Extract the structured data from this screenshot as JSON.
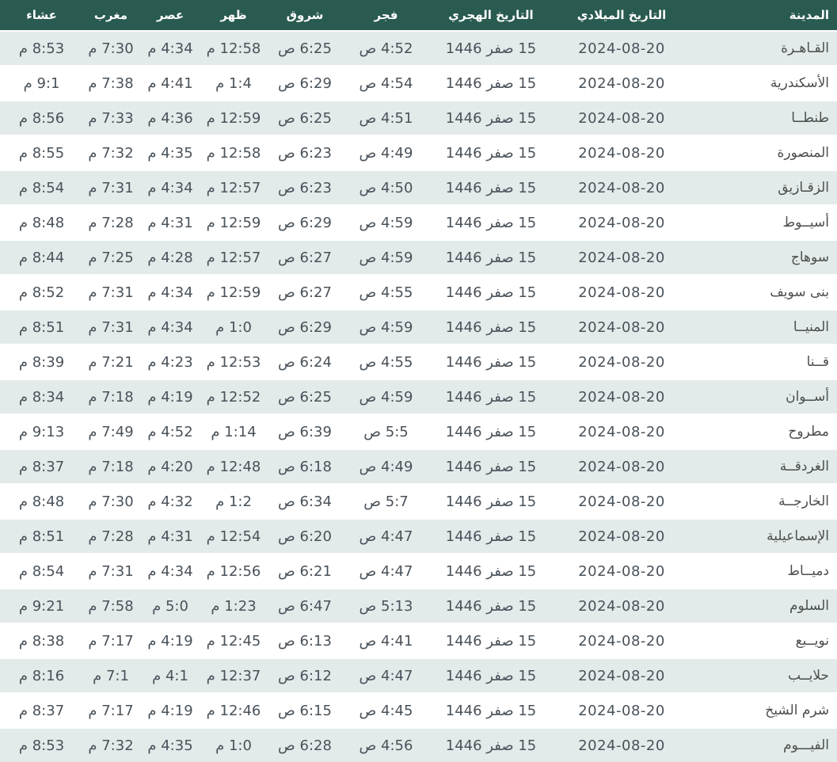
{
  "table": {
    "columns": [
      {
        "key": "city",
        "label": "المدينة"
      },
      {
        "key": "gregorian",
        "label": "التاريخ الميلادي"
      },
      {
        "key": "hijri",
        "label": "التاريخ الهجري"
      },
      {
        "key": "fajr",
        "label": "فجر"
      },
      {
        "key": "shuruq",
        "label": "شروق"
      },
      {
        "key": "dhuhr",
        "label": "ظهر"
      },
      {
        "key": "asr",
        "label": "عصر"
      },
      {
        "key": "maghrib",
        "label": "مغرب"
      },
      {
        "key": "isha",
        "label": "عشاء"
      }
    ],
    "rows": [
      {
        "city": "القـاهـرة",
        "gregorian": "2024-08-20",
        "hijri": "15 صفر 1446",
        "fajr": "4:52 ص",
        "shuruq": "6:25 ص",
        "dhuhr": "12:58 م",
        "asr": "4:34 م",
        "maghrib": "7:30 م",
        "isha": "8:53 م"
      },
      {
        "city": "الأسكندرية",
        "gregorian": "2024-08-20",
        "hijri": "15 صفر 1446",
        "fajr": "4:54 ص",
        "shuruq": "6:29 ص",
        "dhuhr": "1:4 م",
        "asr": "4:41 م",
        "maghrib": "7:38 م",
        "isha": "9:1 م"
      },
      {
        "city": "طنطــا",
        "gregorian": "2024-08-20",
        "hijri": "15 صفر 1446",
        "fajr": "4:51 ص",
        "shuruq": "6:25 ص",
        "dhuhr": "12:59 م",
        "asr": "4:36 م",
        "maghrib": "7:33 م",
        "isha": "8:56 م"
      },
      {
        "city": "المنصورة",
        "gregorian": "2024-08-20",
        "hijri": "15 صفر 1446",
        "fajr": "4:49 ص",
        "shuruq": "6:23 ص",
        "dhuhr": "12:58 م",
        "asr": "4:35 م",
        "maghrib": "7:32 م",
        "isha": "8:55 م"
      },
      {
        "city": "الزقـازيق",
        "gregorian": "2024-08-20",
        "hijri": "15 صفر 1446",
        "fajr": "4:50 ص",
        "shuruq": "6:23 ص",
        "dhuhr": "12:57 م",
        "asr": "4:34 م",
        "maghrib": "7:31 م",
        "isha": "8:54 م"
      },
      {
        "city": "أسيــوط",
        "gregorian": "2024-08-20",
        "hijri": "15 صفر 1446",
        "fajr": "4:59 ص",
        "shuruq": "6:29 ص",
        "dhuhr": "12:59 م",
        "asr": "4:31 م",
        "maghrib": "7:28 م",
        "isha": "8:48 م"
      },
      {
        "city": "سوهاج",
        "gregorian": "2024-08-20",
        "hijri": "15 صفر 1446",
        "fajr": "4:59 ص",
        "shuruq": "6:27 ص",
        "dhuhr": "12:57 م",
        "asr": "4:28 م",
        "maghrib": "7:25 م",
        "isha": "8:44 م"
      },
      {
        "city": "بنى سويف",
        "gregorian": "2024-08-20",
        "hijri": "15 صفر 1446",
        "fajr": "4:55 ص",
        "shuruq": "6:27 ص",
        "dhuhr": "12:59 م",
        "asr": "4:34 م",
        "maghrib": "7:31 م",
        "isha": "8:52 م"
      },
      {
        "city": "المنيــا",
        "gregorian": "2024-08-20",
        "hijri": "15 صفر 1446",
        "fajr": "4:59 ص",
        "shuruq": "6:29 ص",
        "dhuhr": "1:0 م",
        "asr": "4:34 م",
        "maghrib": "7:31 م",
        "isha": "8:51 م"
      },
      {
        "city": "قــنا",
        "gregorian": "2024-08-20",
        "hijri": "15 صفر 1446",
        "fajr": "4:55 ص",
        "shuruq": "6:24 ص",
        "dhuhr": "12:53 م",
        "asr": "4:23 م",
        "maghrib": "7:21 م",
        "isha": "8:39 م"
      },
      {
        "city": "أســوان",
        "gregorian": "2024-08-20",
        "hijri": "15 صفر 1446",
        "fajr": "4:59 ص",
        "shuruq": "6:25 ص",
        "dhuhr": "12:52 م",
        "asr": "4:19 م",
        "maghrib": "7:18 م",
        "isha": "8:34 م"
      },
      {
        "city": "مطروح",
        "gregorian": "2024-08-20",
        "hijri": "15 صفر 1446",
        "fajr": "5:5 ص",
        "shuruq": "6:39 ص",
        "dhuhr": "1:14 م",
        "asr": "4:52 م",
        "maghrib": "7:49 م",
        "isha": "9:13 م"
      },
      {
        "city": "الغردقــة",
        "gregorian": "2024-08-20",
        "hijri": "15 صفر 1446",
        "fajr": "4:49 ص",
        "shuruq": "6:18 ص",
        "dhuhr": "12:48 م",
        "asr": "4:20 م",
        "maghrib": "7:18 م",
        "isha": "8:37 م"
      },
      {
        "city": "الخارجــة",
        "gregorian": "2024-08-20",
        "hijri": "15 صفر 1446",
        "fajr": "5:7 ص",
        "shuruq": "6:34 ص",
        "dhuhr": "1:2 م",
        "asr": "4:32 م",
        "maghrib": "7:30 م",
        "isha": "8:48 م"
      },
      {
        "city": "الإسماعيلية",
        "gregorian": "2024-08-20",
        "hijri": "15 صفر 1446",
        "fajr": "4:47 ص",
        "shuruq": "6:20 ص",
        "dhuhr": "12:54 م",
        "asr": "4:31 م",
        "maghrib": "7:28 م",
        "isha": "8:51 م"
      },
      {
        "city": "دميــاط",
        "gregorian": "2024-08-20",
        "hijri": "15 صفر 1446",
        "fajr": "4:47 ص",
        "shuruq": "6:21 ص",
        "dhuhr": "12:56 م",
        "asr": "4:34 م",
        "maghrib": "7:31 م",
        "isha": "8:54 م"
      },
      {
        "city": "السلوم",
        "gregorian": "2024-08-20",
        "hijri": "15 صفر 1446",
        "fajr": "5:13 ص",
        "shuruq": "6:47 ص",
        "dhuhr": "1:23 م",
        "asr": "5:0 م",
        "maghrib": "7:58 م",
        "isha": "9:21 م"
      },
      {
        "city": "نويــبع",
        "gregorian": "2024-08-20",
        "hijri": "15 صفر 1446",
        "fajr": "4:41 ص",
        "shuruq": "6:13 ص",
        "dhuhr": "12:45 م",
        "asr": "4:19 م",
        "maghrib": "7:17 م",
        "isha": "8:38 م"
      },
      {
        "city": "حلايــب",
        "gregorian": "2024-08-20",
        "hijri": "15 صفر 1446",
        "fajr": "4:47 ص",
        "shuruq": "6:12 ص",
        "dhuhr": "12:37 م",
        "asr": "4:1 م",
        "maghrib": "7:1 م",
        "isha": "8:16 م"
      },
      {
        "city": "شرم الشيخ",
        "gregorian": "2024-08-20",
        "hijri": "15 صفر 1446",
        "fajr": "4:45 ص",
        "shuruq": "6:15 ص",
        "dhuhr": "12:46 م",
        "asr": "4:19 م",
        "maghrib": "7:17 م",
        "isha": "8:37 م"
      },
      {
        "city": "الفيـــوم",
        "gregorian": "2024-08-20",
        "hijri": "15 صفر 1446",
        "fajr": "4:56 ص",
        "shuruq": "6:28 ص",
        "dhuhr": "1:0 م",
        "asr": "4:35 م",
        "maghrib": "7:32 م",
        "isha": "8:53 م"
      }
    ]
  },
  "colors": {
    "header_bg": "#2a5b50",
    "header_text": "#ffffff",
    "stripe_bg": "#e3eaea",
    "row_bg": "#ffffff",
    "cell_text": "#49525a"
  }
}
